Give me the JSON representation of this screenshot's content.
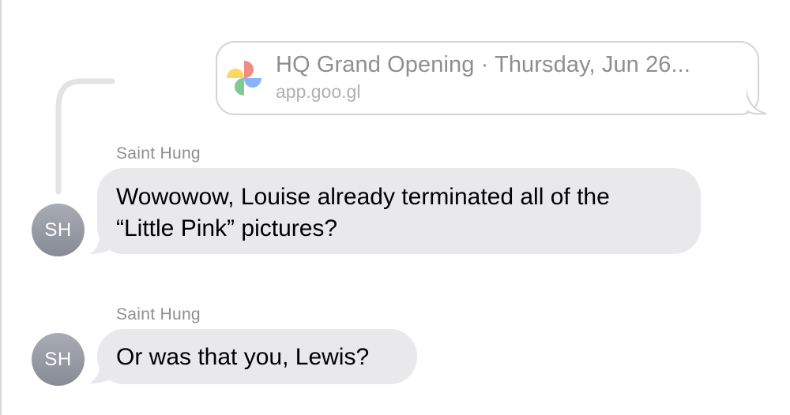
{
  "link_preview": {
    "title": "HQ Grand Opening · Thursday, Jun 26...",
    "domain": "app.goo.gl",
    "icon": "google-photos-icon"
  },
  "messages": [
    {
      "sender": "Saint Hung",
      "avatar_initials": "SH",
      "lines": [
        "Wowowow, Louise already terminated all of the",
        "“Little Pink” pictures?"
      ]
    },
    {
      "sender": "Saint Hung",
      "avatar_initials": "SH",
      "lines": [
        "Or was that you, Lewis?"
      ]
    }
  ],
  "colors": {
    "incoming_bubble": "#e9e9eb",
    "avatar": "#9a9da6",
    "secondary_text": "#8e8e93",
    "link_border": "#d4d4d8"
  }
}
